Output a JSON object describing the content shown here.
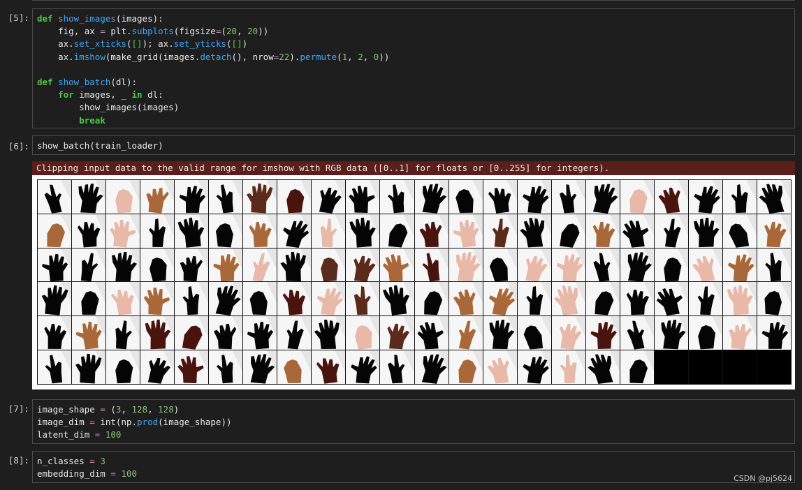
{
  "cells": [
    {
      "prompt": "[5]:",
      "lines": [
        "def show_images(images):",
        "    fig, ax = plt.subplots(figsize=(20, 20))",
        "    ax.set_xticks([]); ax.set_yticks([])",
        "    ax.imshow(make_grid(images.detach(), nrow=22).permute(1, 2, 0))",
        "",
        "def show_batch(dl):",
        "    for images, _ in dl:",
        "        show_images(images)",
        "        break"
      ]
    },
    {
      "prompt": "[6]:",
      "lines": [
        "show_batch(train_loader)"
      ]
    },
    {
      "prompt": "[7]:",
      "lines": [
        "image_shape = (3, 128, 128)",
        "image_dim = int(np.prod(image_shape))",
        "latent_dim = 100"
      ]
    },
    {
      "prompt": "[8]:",
      "lines": [
        "n_classes = 3",
        "embedding_dim = 100"
      ]
    }
  ],
  "output": {
    "warning": "Clipping input data to the valid range for imshow with RGB data ([0..1] for floats or [0..255] for integers).",
    "grid_columns": 22,
    "grid_rows": 6,
    "image_count": 128,
    "hand_tones": [
      "k",
      "k",
      "p",
      "b",
      "k",
      "k",
      "d",
      "r",
      "k",
      "k",
      "k",
      "k",
      "k",
      "k",
      "k",
      "k",
      "k",
      "p",
      "r",
      "k",
      "k",
      "k",
      "b",
      "k",
      "p",
      "k",
      "k",
      "k",
      "b",
      "k",
      "p",
      "k",
      "k",
      "r",
      "p",
      "d",
      "k",
      "k",
      "b",
      "k",
      "k",
      "k",
      "k",
      "b",
      "k",
      "k",
      "k",
      "k",
      "k",
      "b",
      "p",
      "k",
      "d",
      "d",
      "b",
      "r",
      "p",
      "k",
      "p",
      "p",
      "k",
      "k",
      "k",
      "p",
      "b",
      "k",
      "k",
      "k",
      "p",
      "b",
      "k",
      "k",
      "k",
      "r",
      "p",
      "d",
      "k",
      "k",
      "b",
      "b",
      "k",
      "p",
      "k",
      "k",
      "k",
      "k",
      "p",
      "k",
      "k",
      "b",
      "k",
      "r",
      "r",
      "k",
      "k",
      "k",
      "k",
      "p",
      "d",
      "k",
      "b",
      "k",
      "k",
      "p",
      "r",
      "k",
      "k",
      "k",
      "p",
      "k",
      "k",
      "k",
      "k",
      "k",
      "r",
      "k",
      "k",
      "b",
      "r",
      "k",
      "k",
      "k",
      "b",
      "p",
      "k",
      "p",
      "k",
      "k"
    ],
    "tone_colors": {
      "k": "#050505",
      "p": "#e8b8a8",
      "b": "#a8683a",
      "d": "#5a2a1a",
      "r": "#4a140e"
    }
  },
  "watermark": "CSDN @pj5624"
}
